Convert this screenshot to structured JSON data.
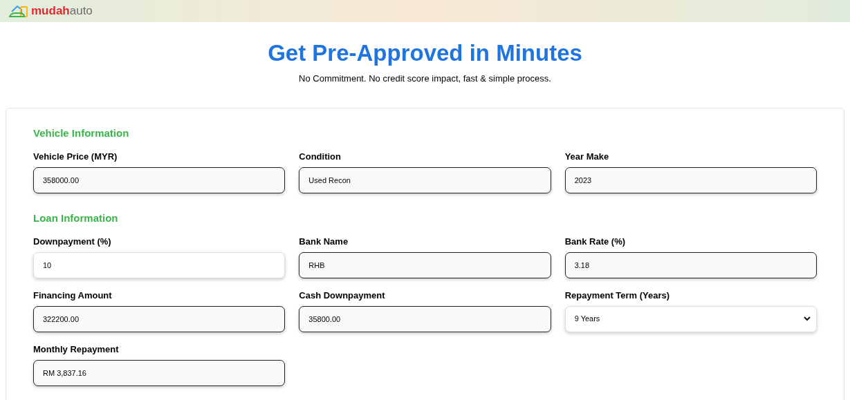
{
  "header": {
    "logo_parts": [
      "mudah",
      "auto"
    ]
  },
  "hero": {
    "title": "Get Pre-Approved in Minutes",
    "subtitle": "No Commitment. No credit score impact, fast & simple process."
  },
  "sections": [
    {
      "heading": "Vehicle Information",
      "fields": [
        {
          "label": "Vehicle Price (MYR)",
          "value": "358000.00",
          "kind": "input",
          "editable": false
        },
        {
          "label": "Condition",
          "value": "Used Recon",
          "kind": "input",
          "editable": false
        },
        {
          "label": "Year Make",
          "value": "2023",
          "kind": "input",
          "editable": false
        }
      ]
    },
    {
      "heading": "Loan Information",
      "fields": [
        {
          "label": "Downpayment (%)",
          "value": "10",
          "kind": "input",
          "editable": true
        },
        {
          "label": "Bank Name",
          "value": "RHB",
          "kind": "input",
          "editable": false
        },
        {
          "label": "Bank Rate (%)",
          "value": "3.18",
          "kind": "input",
          "editable": false
        },
        {
          "label": "Financing Amount",
          "value": "322200.00",
          "kind": "input",
          "editable": false
        },
        {
          "label": "Cash Downpayment",
          "value": "35800.00",
          "kind": "input",
          "editable": false
        },
        {
          "label": "Repayment Term (Years)",
          "value": "9 Years",
          "kind": "select",
          "editable": true
        },
        {
          "label": "Monthly Repayment",
          "value": "RM 3,837.16",
          "kind": "input",
          "editable": false
        }
      ]
    }
  ]
}
